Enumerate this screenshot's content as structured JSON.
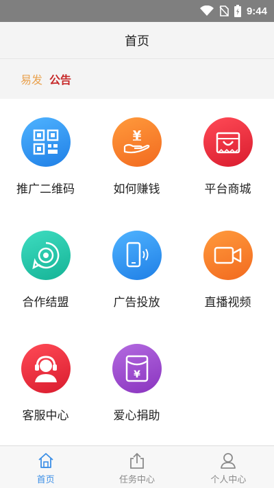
{
  "status_bar": {
    "time": "9:44"
  },
  "header": {
    "title": "首页"
  },
  "notice": {
    "brand": "易发",
    "label": "公告"
  },
  "grid": {
    "items": [
      {
        "label": "推广二维码",
        "icon": "qr-code-icon",
        "color": "#2f8ff0"
      },
      {
        "label": "如何赚钱",
        "icon": "hand-money-icon",
        "color": "#f57c2a"
      },
      {
        "label": "平台商城",
        "icon": "shopping-bag-icon",
        "color": "#e8293b"
      },
      {
        "label": "合作结盟",
        "icon": "target-icon",
        "color": "#22c1a4"
      },
      {
        "label": "广告投放",
        "icon": "phone-signal-icon",
        "color": "#2a8ef0"
      },
      {
        "label": "直播视频",
        "icon": "video-camera-icon",
        "color": "#f57c2a"
      },
      {
        "label": "客服中心",
        "icon": "headset-user-icon",
        "color": "#e8293b"
      },
      {
        "label": "爱心捐助",
        "icon": "red-envelope-icon",
        "color": "#9c47c9"
      }
    ]
  },
  "tabbar": {
    "tabs": [
      {
        "label": "首页",
        "icon": "home-icon",
        "active": true
      },
      {
        "label": "任务中心",
        "icon": "share-icon",
        "active": false
      },
      {
        "label": "个人中心",
        "icon": "user-icon",
        "active": false
      }
    ]
  },
  "colors": {
    "active_tab": "#3a8ee6",
    "notice_brand": "#e9a24f",
    "notice_label": "#c62828"
  }
}
